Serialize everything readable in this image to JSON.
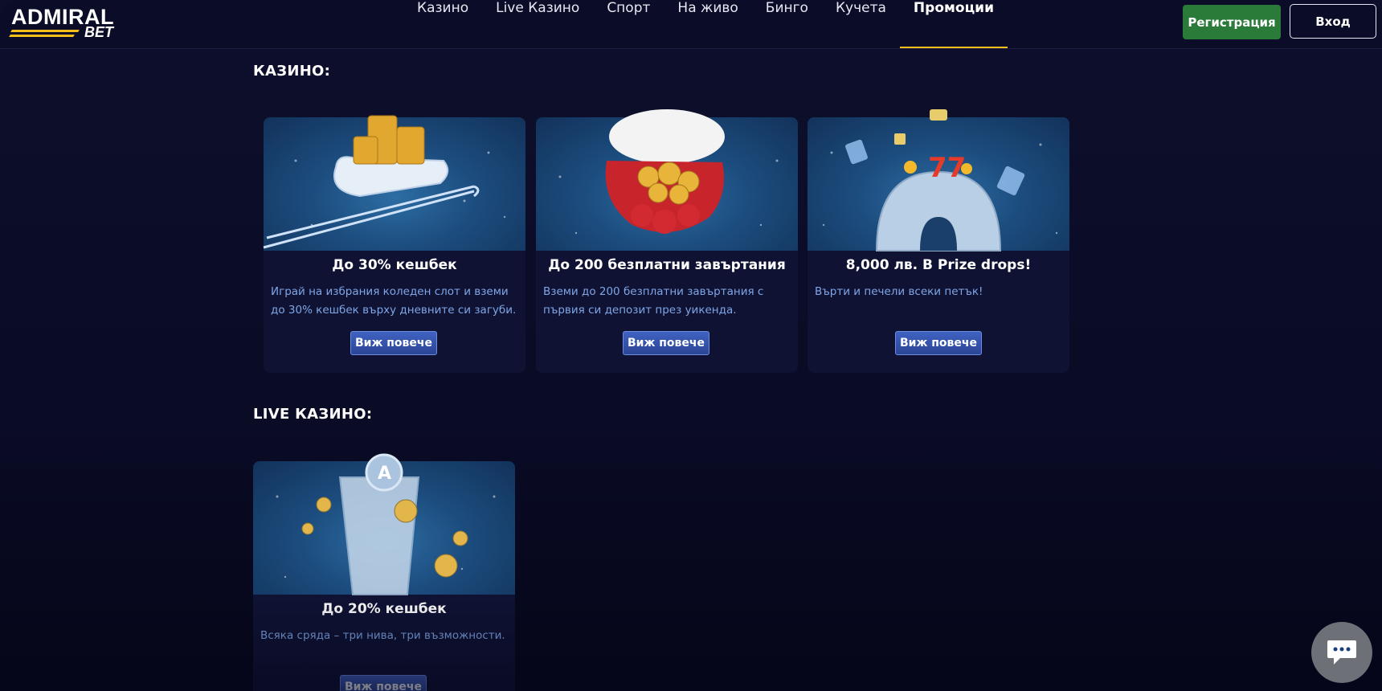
{
  "brand": {
    "name": "ADMIRAL",
    "sub": "BET"
  },
  "nav": {
    "items": [
      {
        "label": "Казино"
      },
      {
        "label": "Live Казино"
      },
      {
        "label": "Спорт"
      },
      {
        "label": "На живо"
      },
      {
        "label": "Бинго"
      },
      {
        "label": "Кучета"
      },
      {
        "label": "Промоции",
        "active": true
      }
    ],
    "register_label": "Регистрация",
    "login_label": "Вход"
  },
  "sections": [
    {
      "title": "КАЗИНО:",
      "cards": [
        {
          "title": "До 30% кешбек",
          "desc": "Играй на избрания коледен слот и вземи до 30% кешбек върху дневните си загуби.",
          "button": "Виж повече",
          "image_icon": "sleigh-with-coins"
        },
        {
          "title": "До 200 безплатни завъртания",
          "desc": "Вземи до 200 безплатни завъртания с първия си депозит през уикенда.",
          "button": "Виж повече",
          "image_icon": "mitten-with-coins"
        },
        {
          "title": "8,000 лв. В Prize drops!",
          "desc": "Върти и печели всеки петък!",
          "button": "Виж повече",
          "image_icon": "igloo-with-slot-symbols"
        }
      ]
    },
    {
      "title": "LIVE КАЗИНО:",
      "cards": [
        {
          "title": "До 20% кешбек",
          "desc": "Всяка сряда – три нива, три възможности.",
          "button": "Виж повече",
          "image_icon": "ice-trophy-with-coins"
        }
      ]
    }
  ],
  "chat": {
    "icon": "chat-bubble-icon",
    "color": "#6e7077"
  },
  "colors": {
    "accent": "#f4c019",
    "register": "#2a7a3a",
    "background": "#0b0d28",
    "link_text": "#7fa6e6"
  }
}
